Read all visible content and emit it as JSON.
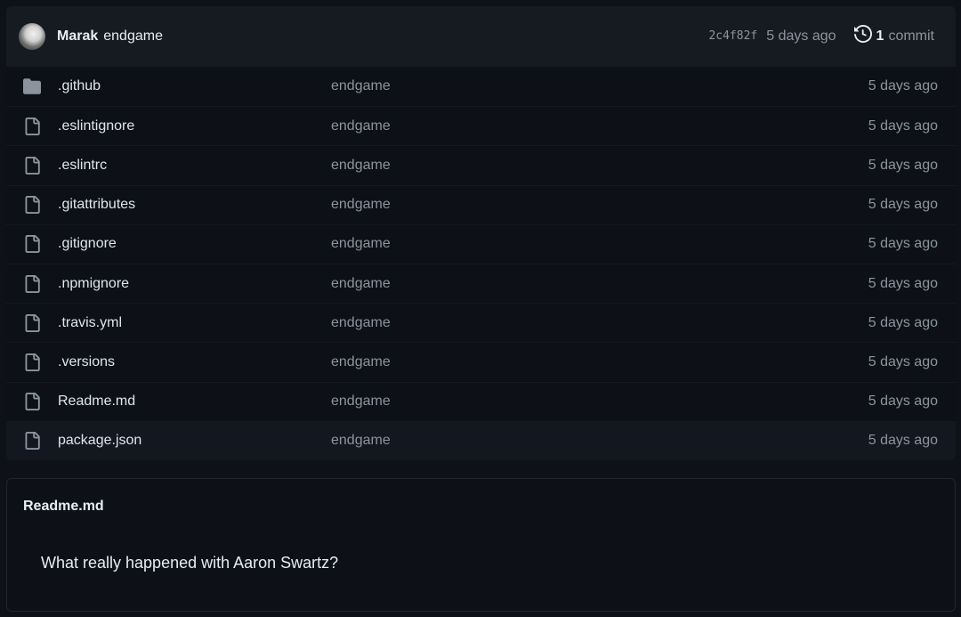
{
  "commit": {
    "author": "Marak",
    "message": "endgame",
    "sha": "2c4f82f",
    "date": "5 days ago",
    "history_count": "1",
    "history_label": "commit"
  },
  "files": [
    {
      "name": ".github",
      "type": "folder",
      "message": "endgame",
      "date": "5 days ago"
    },
    {
      "name": ".eslintignore",
      "type": "file",
      "message": "endgame",
      "date": "5 days ago"
    },
    {
      "name": ".eslintrc",
      "type": "file",
      "message": "endgame",
      "date": "5 days ago"
    },
    {
      "name": ".gitattributes",
      "type": "file",
      "message": "endgame",
      "date": "5 days ago"
    },
    {
      "name": ".gitignore",
      "type": "file",
      "message": "endgame",
      "date": "5 days ago"
    },
    {
      "name": ".npmignore",
      "type": "file",
      "message": "endgame",
      "date": "5 days ago"
    },
    {
      "name": ".travis.yml",
      "type": "file",
      "message": "endgame",
      "date": "5 days ago"
    },
    {
      "name": ".versions",
      "type": "file",
      "message": "endgame",
      "date": "5 days ago"
    },
    {
      "name": "Readme.md",
      "type": "file",
      "message": "endgame",
      "date": "5 days ago"
    },
    {
      "name": "package.json",
      "type": "file",
      "message": "endgame",
      "date": "5 days ago"
    }
  ],
  "readme": {
    "title": "Readme.md",
    "content": "What really happened with Aaron Swartz?"
  },
  "icons": {
    "folder": "folder-icon",
    "file": "file-icon",
    "history": "history-icon"
  },
  "colors": {
    "background": "#0d1117",
    "header": "#161b22",
    "muted": "#8b949e",
    "text": "#e6edf3"
  }
}
